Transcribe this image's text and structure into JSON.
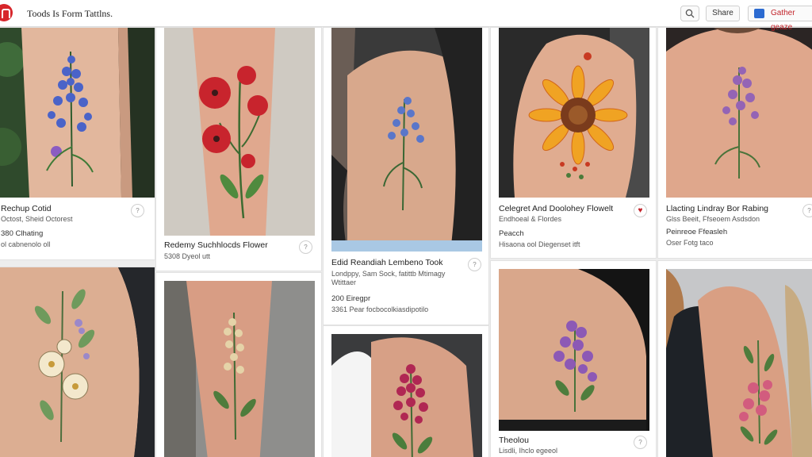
{
  "header": {
    "title": "Toods Is Form Tattlns.",
    "share_label": "Share",
    "save_label": "Gather geaze",
    "logo_icon": "pinterest-logo",
    "search_icon": "search-icon",
    "brand_color": "#d7262b"
  },
  "pins": [
    {
      "title": "Rechup Cotid",
      "subtitle": "Octost, Sheid Octorest",
      "meta": "380 Clhating",
      "extra": "ol cabnenolo oll",
      "action_icon": "pin-icon"
    },
    {
      "title": "Redemy Suchhlocds Flower",
      "subtitle": "5308 Dyeol utt",
      "action_icon": "pin-icon"
    },
    {
      "title": "Edid Reandiah Lembeno Took",
      "subtitle": "Londppy, Sam Sock, fatittb Mtimagy",
      "meta2": "Wtittaer",
      "meta": "200 Eiregpr",
      "extra": "3361 Pear focbocolkiasdipotilo",
      "action_icon": "pin-icon"
    },
    {
      "title": "Celegret And Doolohey Flowelt",
      "subtitle": "Endhoeal & Flordes",
      "meta": "Peacch",
      "extra": "Hisaona ool Diegenset itft",
      "action_icon": "heart-icon"
    },
    {
      "title": "Llacting Lindray Bor Rabing",
      "subtitle": "Glss Beeit, Ffseoem Asdsdon",
      "meta": "Peinreoe Ffeasleh",
      "extra": "Oser Fotg taco",
      "action_icon": "pin-icon"
    },
    {
      "title": "Theolou",
      "subtitle": "Lisdli, Ihclo egeeol",
      "action_icon": "pin-icon"
    }
  ]
}
